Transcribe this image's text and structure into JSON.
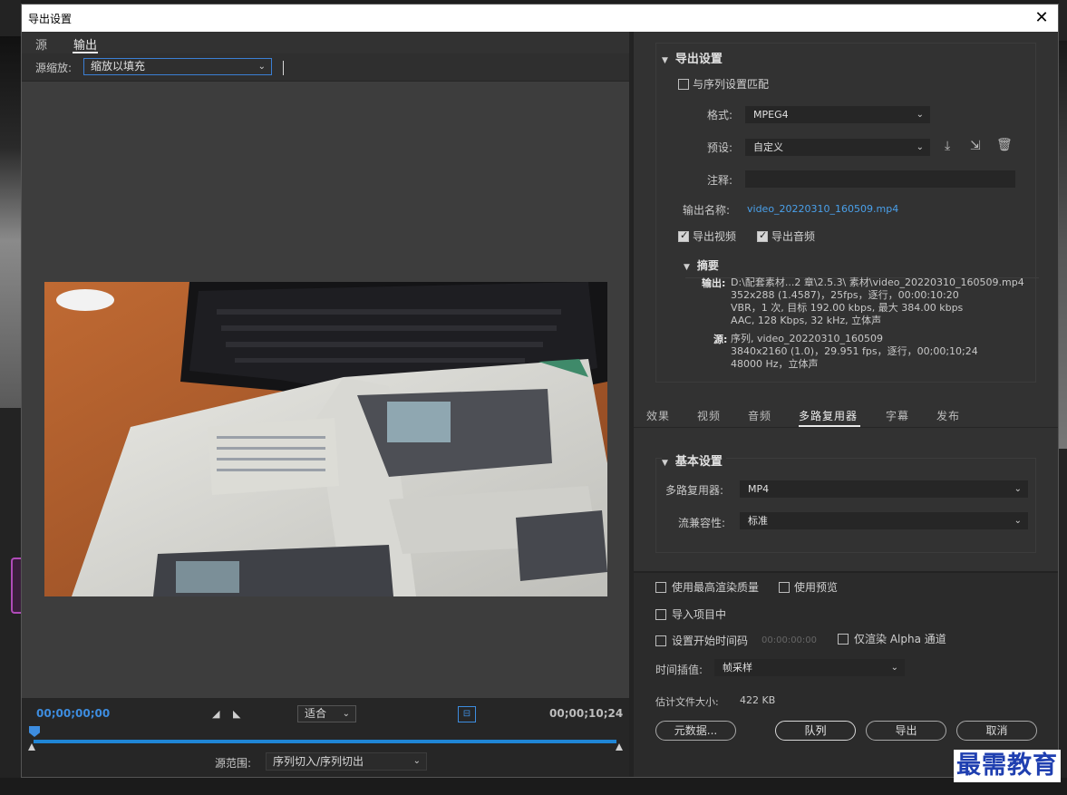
{
  "dialog": {
    "title": "导出设置",
    "close": "✕"
  },
  "left": {
    "tabs": [
      "源",
      "输出"
    ],
    "scale_label": "源缩放:",
    "scale_value": "缩放以填充",
    "timecode_start": "00;00;00;00",
    "timecode_end": "00;00;10;24",
    "fit_value": "适合",
    "range_label": "源范围:",
    "range_value": "序列切入/序列切出"
  },
  "export_settings": {
    "header": "导出设置",
    "match_sequence": "与序列设置匹配",
    "format_label": "格式:",
    "format_value": "MPEG4",
    "preset_label": "预设:",
    "preset_value": "自定义",
    "comment_label": "注释:",
    "output_name_label": "输出名称:",
    "output_name": "video_20220310_160509.mp4",
    "export_video": "导出视频",
    "export_audio": "导出音频",
    "summary": {
      "header": "摘要",
      "output_label": "输出:",
      "output_lines": [
        "D:\\配套素材...2 章\\2.5.3\\ 素材\\video_20220310_160509.mp4",
        "352x288 (1.4587)，25fps，逐行，00:00:10:20",
        "VBR，1 次, 目标 192.00 kbps, 最大 384.00 kbps",
        "AAC, 128 Kbps, 32  kHz, 立体声"
      ],
      "source_label": "源:",
      "source_lines": [
        "序列, video_20220310_160509",
        "3840x2160 (1.0)，29.951 fps，逐行，00;00;10;24",
        "48000 Hz，立体声"
      ]
    }
  },
  "right_tabs": [
    "效果",
    "视频",
    "音频",
    "多路复用器",
    "字幕",
    "发布"
  ],
  "basic_settings": {
    "header": "基本设置",
    "mux_label": "多路复用器:",
    "mux_value": "MP4",
    "compat_label": "流兼容性:",
    "compat_value": "标准"
  },
  "bottom": {
    "max_quality": "使用最高渲染质量",
    "use_preview": "使用预览",
    "import_project": "导入项目中",
    "set_timecode": "设置开始时间码",
    "timecode_value": "00:00:00:00",
    "alpha_only": "仅渲染 Alpha 通道",
    "interp_label": "时间插值:",
    "interp_value": "帧采样",
    "filesize_label": "估计文件大小:",
    "filesize_value": "422 KB",
    "buttons": {
      "metadata": "元数据...",
      "queue": "队列",
      "export": "导出",
      "cancel": "取消"
    }
  },
  "watermark": "最需教育",
  "colors": {
    "accent": "#3d8de0",
    "link": "#4aa0ea",
    "track": "#1f86d6"
  }
}
